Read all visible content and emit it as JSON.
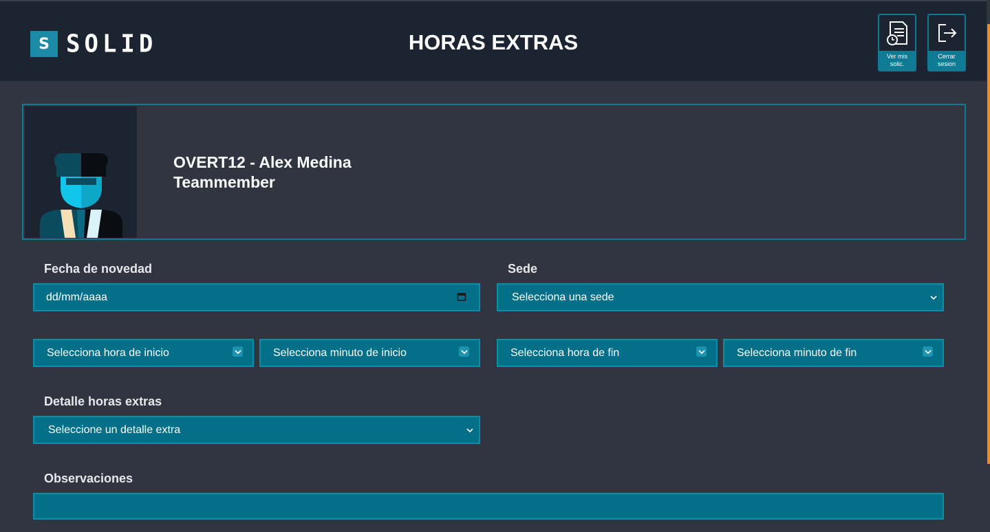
{
  "header": {
    "logo_letter": "S",
    "logo_word": "SOLID",
    "title": "HORAS EXTRAS",
    "my_requests_label": "Ver mis solic.",
    "logout_label": "Cerrar sesion"
  },
  "profile": {
    "name": "OVERT12 - Alex Medina",
    "role": "Teammember"
  },
  "form": {
    "date_label": "Fecha de novedad",
    "date_placeholder": "dd/mm/aaaa",
    "site_label": "Sede",
    "site_value": "Selecciona una sede",
    "start_hour": "Selecciona hora de inicio",
    "start_minute": "Selecciona minuto de inicio",
    "end_hour": "Selecciona hora de fin",
    "end_minute": "Selecciona minuto de fin",
    "detail_label": "Detalle horas extras",
    "detail_value": "Seleccione un detalle extra",
    "observations_label": "Observaciones",
    "observations_value": ""
  },
  "colors": {
    "header_bg": "#1c2431",
    "page_bg": "#303540",
    "accent": "#0e7a93",
    "field_bg": "#036f89",
    "scroll_accent": "#f28c1e"
  }
}
